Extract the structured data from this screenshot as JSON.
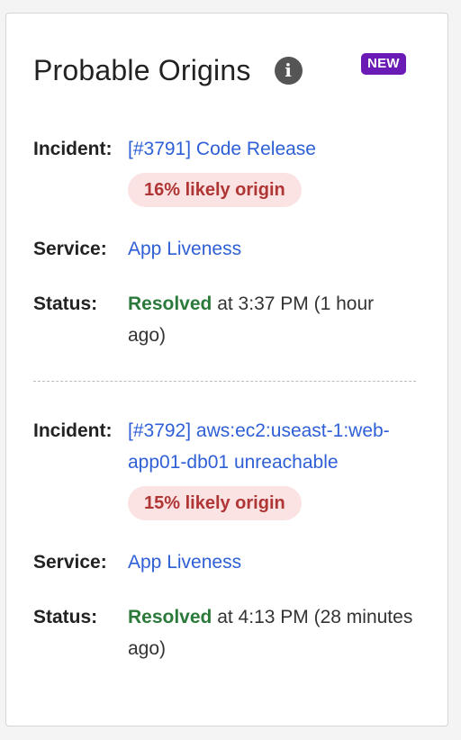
{
  "panel": {
    "title": "Probable Origins",
    "info_icon": "info-icon",
    "badge": "NEW",
    "badge_color": "#6a1bb5"
  },
  "labels": {
    "incident": "Incident:",
    "service": "Service:",
    "status": "Status:"
  },
  "origins": [
    {
      "incident": "[#3791] Code Release",
      "likelihood": "16% likely origin",
      "service": "App Liveness",
      "status": "Resolved",
      "status_detail": " at 3:37 PM (1 hour ago)"
    },
    {
      "incident": "[#3792] aws:ec2:useast-1:web-app01-db01 unreachable",
      "likelihood": "15% likely origin",
      "service": "App Liveness",
      "status": "Resolved",
      "status_detail": " at 4:13 PM (28 minutes ago)"
    }
  ],
  "colors": {
    "link": "#2e5fd6",
    "resolved": "#2c7a3b",
    "likelihood_text": "#b03535",
    "likelihood_bg": "#fbe3e3"
  }
}
